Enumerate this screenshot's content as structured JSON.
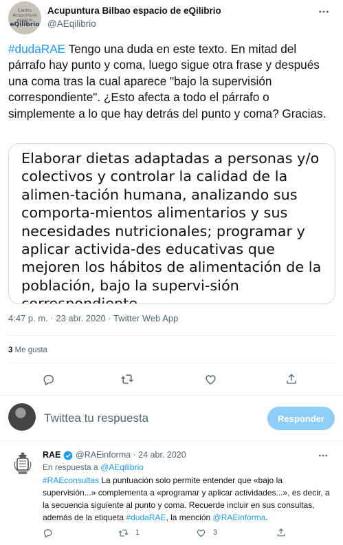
{
  "tweet": {
    "author_name": "Acupuntura Bilbao espacio de eQilibrio",
    "author_handle": "@AEqilibrio",
    "avatar_text": {
      "line1": "Centro",
      "line2": "Acupuntura",
      "line3": "espacio",
      "line4": "eQilibrio"
    },
    "hashtag": "#dudaRAE",
    "text": " Tengo una duda en este texto. En mitad del párrafo hay punto y coma, luego sigue otra frase y después una coma tras la cual aparece \"bajo la supervisión correspondiente\". ¿Esto afecta a todo el párrafo o simplemente a lo que hay detrás del punto y coma? Gracias.",
    "media_text": "Elaborar dietas adaptadas a personas y/o colectivos y controlar la calidad de la alimen-tación humana, analizando sus comporta-mientos alimentarios y sus necesidades nutricionales; programar y aplicar activida-des educativas que mejoren los hábitos de alimentación de la población, bajo la supervi-sión correspondiente.",
    "meta": "4:47 p. m. · 23 abr. 2020 · Twitter Web App",
    "likes_count": "3",
    "likes_label": "Me gusta"
  },
  "composer": {
    "placeholder": "Twittea tu respuesta",
    "button_label": "Responder"
  },
  "reply": {
    "name": "RAE",
    "handle_date": "@RAEinforma · 24 abr. 2020",
    "replying_prefix": "En respuesta a ",
    "replying_handle": "@AEqilibrio",
    "hashtag_consultas": "#RAEconsultas",
    "text1": " La puntuación solo permite entender que «bajo la supervisión...» complementa a «programar y aplicar actividades...», es decir, a la secuencia siguiente al punto y coma. Recuerde incluir en sus consultas, además de la etiqueta ",
    "hashtag_duda": "#dudaRAE",
    "text2": ", la mención ",
    "mention": "@RAEinforma",
    "text3": ".",
    "retweets": "1",
    "likes": "3"
  },
  "colors": {
    "accent": "#1d9bf0",
    "muted": "#536471",
    "button_disabled": "#8ecdf8"
  },
  "icons": [
    "more-icon",
    "reply-icon",
    "retweet-icon",
    "like-icon",
    "share-icon",
    "verified-icon"
  ]
}
